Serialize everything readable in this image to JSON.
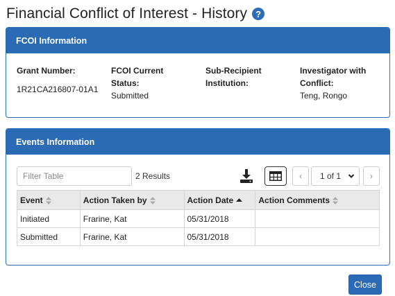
{
  "page": {
    "title": "Financial Conflict of Interest - History",
    "help_icon": "question-circle"
  },
  "fcoi": {
    "header": "FCOI Information",
    "fields": [
      {
        "label": "Grant Number:",
        "value": "1R21CA216807-01A1"
      },
      {
        "label": "FCOI Current Status:",
        "value": "Submitted"
      },
      {
        "label": "Sub-Recipient Institution:",
        "value": ""
      },
      {
        "label": "Investigator with Conflict:",
        "value": "Teng, Rongo"
      }
    ]
  },
  "events": {
    "header": "Events Information",
    "filter_placeholder": "Filter Table",
    "results": "2 Results",
    "page_label": "1 of 1",
    "columns": [
      "Event",
      "Action Taken by",
      "Action Date",
      "Action Comments"
    ],
    "rows": [
      [
        "Initiated",
        "Frarine, Kat",
        "05/31/2018",
        ""
      ],
      [
        "Submitted",
        "Frarine, Kat",
        "05/31/2018",
        ""
      ]
    ]
  },
  "footer": {
    "close_label": "Close"
  },
  "colors": {
    "accent": "#2b6bb5",
    "header_bg": "#e9e9e9"
  }
}
